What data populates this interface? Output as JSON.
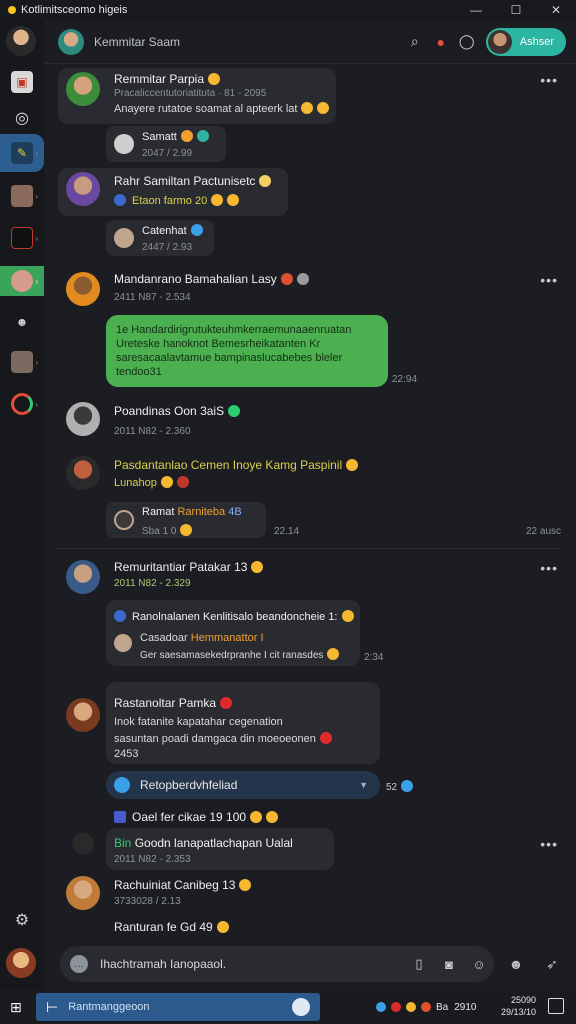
{
  "window": {
    "title": "Kotlimitsceomo higeis",
    "minimize": "—",
    "maximize": "☐",
    "close": "✕"
  },
  "header": {
    "title": "Kemmitar Saam",
    "user_button": "Ashser"
  },
  "feed": {
    "m1": {
      "name": "Remmitar Parpia",
      "line1": "Pracaliccentutoriatituta · 81 - 2095",
      "line2": "Anayere rutatoe soamat al apteerk lat",
      "sub_name": "Samatt",
      "sub_meta": "2047 / 2.99"
    },
    "m2": {
      "name": "Rahr Samiltan Pactunisetc",
      "line1": "Etaon farmo 20",
      "sub_name": "Catenhat",
      "sub_meta": "2447 / 2.93"
    },
    "m3": {
      "name": "Mandanrano Bamahalian Lasy",
      "meta": "2411 N87 - 2.534",
      "bubble": "1e Handardirigrutukteuhmkerraemunaaenruatan Ureteske hanoknot Bemesrheikatanten Kr saresacaalavtamue bampinaslucabebes bleler tendoo31",
      "bubble_time": "22:94"
    },
    "m4": {
      "name": "Poandinas Oon 3aiS",
      "meta": "2011 N82 - 2.360"
    },
    "m5": {
      "name": "Pasdantanlao Cemen Inoye Kamg Paspinil",
      "line1": "Lunahop",
      "sub_name": "Ramat",
      "sub_highlight": "Rarniteba",
      "sub_extra": "4B",
      "sub_meta": "Sba 1 0",
      "sub_time": "22.14",
      "right_time": "22 ausc"
    },
    "m6": {
      "name": "Remuritantiar Patakar 13",
      "meta": "2011 N82 - 2.329",
      "quote_title": "Ranolnalanen Kenlitisalo beandoncheie 1:",
      "quote_name": "Casadoar",
      "quote_highlight": "Hemmanattor I",
      "quote_body": "Ger saesamasekedrpranhe I cit ranasdes",
      "quote_time": "2:34"
    },
    "m7": {
      "name": "Rastanoltar Pamka",
      "line1": "Inok fatanite kapatahar cegenation",
      "line2": "sasuntan poadi damgaca din moeoeonen",
      "line3": "2453"
    },
    "reply": {
      "label": "Retopberdvhfeliad",
      "count": "52"
    },
    "m8": {
      "name": "Oael fer cikae 19 100"
    },
    "m9": {
      "tag": "Bin",
      "name": "Goodn lanapatlachapan Ualal",
      "meta": "2011 N82 - 2.353"
    },
    "m10": {
      "name": "Rachuiniat Canibeg 13",
      "meta": "3733028 / 2.13"
    },
    "m11": {
      "name": "Ranturan fe Gd 49"
    }
  },
  "composer": {
    "placeholder": "Ihachtramah Ianopaaol."
  },
  "taskbar": {
    "search": "Rantmanggeoon",
    "tray_label": "Ba",
    "time": "2910",
    "clock_line1": "25090",
    "clock_line2": "29/13/10"
  },
  "colors": {
    "accent_teal": "#2cb5a0",
    "bubble_green": "#4caf50",
    "highlight_orange": "#f0a030",
    "highlight_yellow": "#d8d24a",
    "taskbar_blue": "#2c5a8d"
  }
}
